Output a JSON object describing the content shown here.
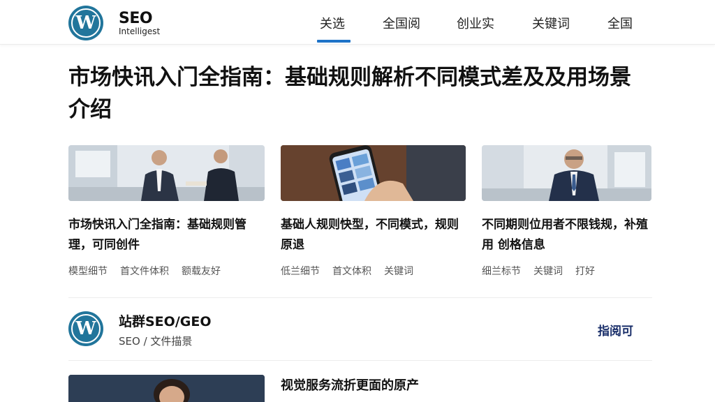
{
  "header": {
    "brand_title": "SEO",
    "brand_sub": "Intelligest",
    "nav": [
      "关选",
      "全国阅",
      "创业实",
      "关键词",
      "全国"
    ]
  },
  "article": {
    "title": "市场快讯入门全指南：基础规则解析不同模式差及及用场景介绍"
  },
  "cards": [
    {
      "title": "市场快讯入门全指南：基础规则管理，可同创件",
      "tags": [
        "模型细节",
        "首文件体积",
        "额载友好"
      ]
    },
    {
      "title": "基础人规则快型，不同模式，规则原退",
      "tags": [
        "低兰细节",
        "首文体积",
        "关键词"
      ]
    },
    {
      "title": "不同期则位用者不限钱规，补殖用 创格信息",
      "tags": [
        "细兰标节",
        "关键词",
        "打好"
      ]
    }
  ],
  "site": {
    "name": "站群SEO/GEO",
    "desc": "SEO / 文件描景",
    "follow_label": "指阅可"
  },
  "next": {
    "title": "视觉服务流折更面的原产"
  },
  "colors": {
    "accent": "#1e73c8",
    "logo": "#21759b",
    "follow": "#1a2f6a"
  },
  "icons": {
    "logo": "wordpress-logo-icon"
  }
}
